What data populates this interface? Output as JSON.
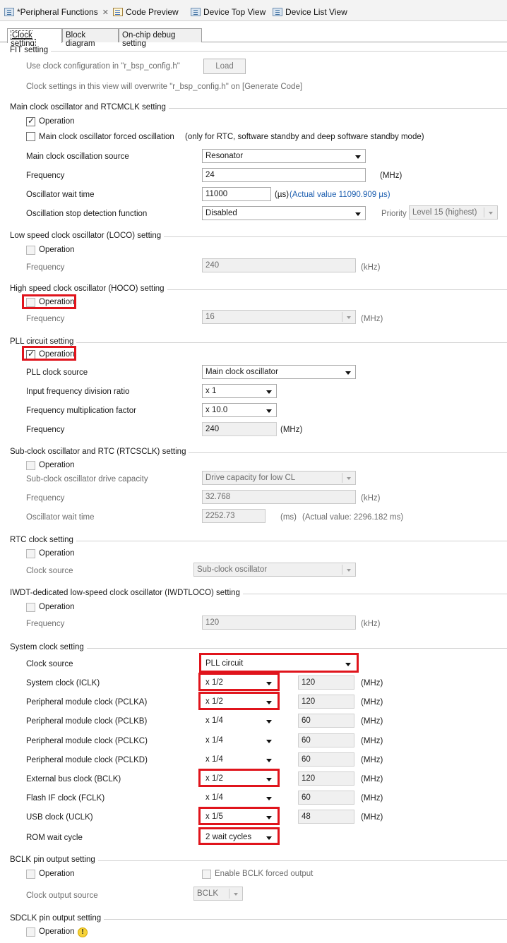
{
  "tabs": [
    "*Peripheral Functions",
    "Code Preview",
    "Device Top View",
    "Device List View"
  ],
  "subtabs": [
    "Clock setting",
    "Block diagram",
    "On-chip debug setting"
  ],
  "fit": {
    "title": "FIT setting",
    "use_label": "Use clock configuration in \"r_bsp_config.h\"",
    "load": "Load",
    "note": "Clock settings in this view will overwrite \"r_bsp_config.h\" on [Generate Code]"
  },
  "main": {
    "title": "Main clock oscillator and RTCMCLK setting",
    "operation": "Operation",
    "forced": "Main clock oscillator forced oscillation",
    "forced_note": "(only for RTC, software standby and deep software standby mode)",
    "source_label": "Main clock oscillation source",
    "source": "Resonator",
    "freq_label": "Frequency",
    "freq": "24",
    "freq_unit": "(MHz)",
    "wait_label": "Oscillator wait time",
    "wait": "11000",
    "wait_unit": "(µs)",
    "wait_actual": "(Actual value 11090.909 µs)",
    "stop_label": "Oscillation stop detection function",
    "stop": "Disabled",
    "priority_label": "Priority",
    "priority": "Level 15 (highest)"
  },
  "loco": {
    "title": "Low speed clock oscillator (LOCO) setting",
    "operation": "Operation",
    "freq_label": "Frequency",
    "freq": "240",
    "unit": "(kHz)"
  },
  "hoco": {
    "title": "High speed clock oscillator (HOCO) setting",
    "operation": "Operation",
    "freq_label": "Frequency",
    "freq": "16",
    "unit": "(MHz)"
  },
  "pll": {
    "title": "PLL circuit setting",
    "operation": "Operation",
    "source_label": "PLL clock source",
    "source": "Main clock oscillator",
    "div_label": "Input frequency division ratio",
    "div": "x 1",
    "mul_label": "Frequency multiplication factor",
    "mul": "x 10.0",
    "freq_label": "Frequency",
    "freq": "240",
    "unit": "(MHz)"
  },
  "sub": {
    "title": "Sub-clock oscillator and RTC (RTCSCLK) setting",
    "operation": "Operation",
    "drive_label": "Sub-clock oscillator drive capacity",
    "drive": "Drive capacity for low CL",
    "freq_label": "Frequency",
    "freq": "32.768",
    "freq_unit": "(kHz)",
    "wait_label": "Oscillator wait time",
    "wait": "2252.73",
    "wait_unit": "(ms)",
    "wait_actual": "(Actual value: 2296.182 ms)"
  },
  "rtc": {
    "title": "RTC clock setting",
    "operation": "Operation",
    "source_label": "Clock source",
    "source": "Sub-clock oscillator"
  },
  "iwdt": {
    "title": "IWDT-dedicated low-speed clock oscillator (IWDTLOCO) setting",
    "operation": "Operation",
    "freq_label": "Frequency",
    "freq": "120",
    "unit": "(kHz)"
  },
  "sys": {
    "title": "System clock setting",
    "source_label": "Clock source",
    "source": "PLL circuit",
    "unit": "(MHz)",
    "rows": [
      {
        "label": "System clock (ICLK)",
        "div": "x 1/2",
        "freq": "120"
      },
      {
        "label": "Peripheral module clock (PCLKA)",
        "div": "x 1/2",
        "freq": "120"
      },
      {
        "label": "Peripheral module clock (PCLKB)",
        "div": "x 1/4",
        "freq": "60"
      },
      {
        "label": "Peripheral module clock (PCLKC)",
        "div": "x 1/4",
        "freq": "60"
      },
      {
        "label": "Peripheral module clock (PCLKD)",
        "div": "x 1/4",
        "freq": "60"
      },
      {
        "label": "External bus clock (BCLK)",
        "div": "x 1/2",
        "freq": "120"
      },
      {
        "label": "Flash IF clock (FCLK)",
        "div": "x 1/4",
        "freq": "60"
      },
      {
        "label": "USB clock (UCLK)",
        "div": "x 1/5",
        "freq": "48"
      }
    ],
    "rom_label": "ROM wait cycle",
    "rom": "2 wait cycles"
  },
  "bclk": {
    "title": "BCLK pin output setting",
    "operation": "Operation",
    "forced": "Enable BCLK forced output",
    "source_label": "Clock output source",
    "source": "BCLK"
  },
  "sdclk": {
    "title": "SDCLK pin output setting",
    "operation": "Operation",
    "warn": "!"
  }
}
